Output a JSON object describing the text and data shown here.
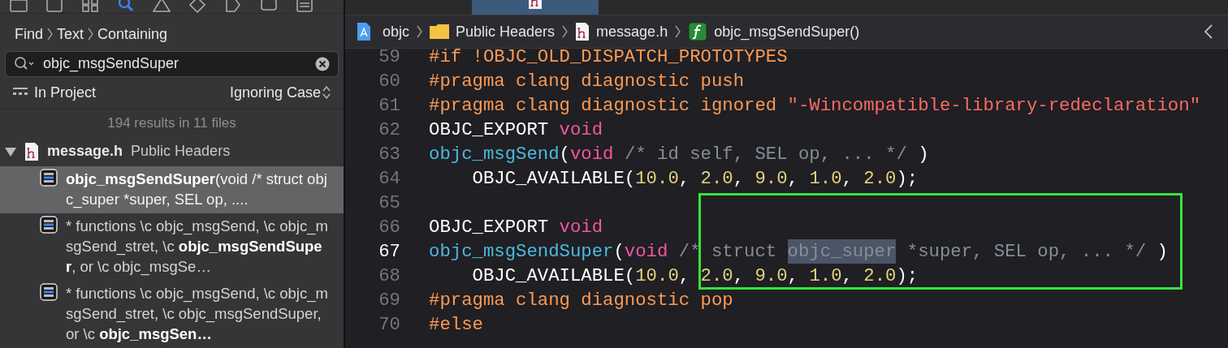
{
  "navigator": {
    "icons": [
      {
        "kind": "folder",
        "selected": false
      },
      {
        "kind": "square",
        "selected": false
      },
      {
        "kind": "grid",
        "selected": false
      },
      {
        "kind": "search",
        "selected": true
      },
      {
        "kind": "warning",
        "selected": false
      },
      {
        "kind": "diamond",
        "selected": false
      },
      {
        "kind": "tag",
        "selected": false
      },
      {
        "kind": "bubble",
        "selected": false
      },
      {
        "kind": "list",
        "selected": false
      }
    ],
    "find_path": [
      "Find",
      "Text",
      "Containing"
    ],
    "search": {
      "value": "objc_msgSendSuper"
    },
    "scope": "In Project",
    "matching": "Ignoring Case",
    "summary": "194 results in 11 files",
    "file": {
      "name": "message.h",
      "group": "Public Headers",
      "expanded": true
    },
    "results": [
      {
        "selected": true,
        "parts": [
          {
            "text": "objc_msgSendSuper",
            "bold": true
          },
          {
            "text": "(void /* struct objc_super *super, SEL op, ....",
            "bold": false
          }
        ]
      },
      {
        "selected": false,
        "parts": [
          {
            "text": "*  functions \\c objc_msgSend, \\c objc_msgSend_stret, \\c ",
            "bold": false
          },
          {
            "text": "objc_msgSendSuper",
            "bold": true
          },
          {
            "text": ", or \\c objc_msgSe…",
            "bold": false
          }
        ]
      },
      {
        "selected": false,
        "parts": [
          {
            "text": "*  functions \\c objc_msgSend, \\c objc_msgSend_stret, \\c objc_msgSendSuper, or \\c ",
            "bold": false
          },
          {
            "text": "objc_msgSen…",
            "bold": true
          }
        ]
      }
    ]
  },
  "breadcrumb": [
    {
      "kind": "project",
      "label": "objc"
    },
    {
      "kind": "folder",
      "label": "Public Headers"
    },
    {
      "kind": "header",
      "label": "message.h"
    },
    {
      "kind": "function",
      "label": "objc_msgSendSuper()"
    }
  ],
  "code": [
    {
      "number": "59",
      "current": false,
      "tokens": [
        {
          "kind": "preproc",
          "text": "#if !OBJC_OLD_DISPATCH_PROTOTYPES"
        }
      ]
    },
    {
      "number": "60",
      "current": false,
      "tokens": [
        {
          "kind": "preproc",
          "text": "#pragma clang diagnostic push"
        }
      ]
    },
    {
      "number": "61",
      "current": false,
      "tokens": [
        {
          "kind": "preproc",
          "text": "#pragma clang diagnostic ignored "
        },
        {
          "kind": "string",
          "text": "\"-Wincompatible-library-redeclaration\""
        }
      ]
    },
    {
      "number": "62",
      "current": false,
      "tokens": [
        {
          "kind": "plain",
          "text": "OBJC_EXPORT "
        },
        {
          "kind": "keyword",
          "text": "void"
        }
      ]
    },
    {
      "number": "63",
      "current": false,
      "tokens": [
        {
          "kind": "function",
          "text": "objc_msgSend"
        },
        {
          "kind": "plain",
          "text": "("
        },
        {
          "kind": "keyword",
          "text": "void"
        },
        {
          "kind": "comment",
          "text": " /* id self, SEL op, ... */"
        },
        {
          "kind": "plain",
          "text": " )"
        }
      ]
    },
    {
      "number": "64",
      "current": false,
      "tokens": [
        {
          "kind": "plain",
          "text": "    OBJC_AVAILABLE("
        },
        {
          "kind": "number",
          "text": "10.0"
        },
        {
          "kind": "plain",
          "text": ", "
        },
        {
          "kind": "number",
          "text": "2.0"
        },
        {
          "kind": "plain",
          "text": ", "
        },
        {
          "kind": "number",
          "text": "9.0"
        },
        {
          "kind": "plain",
          "text": ", "
        },
        {
          "kind": "number",
          "text": "1.0"
        },
        {
          "kind": "plain",
          "text": ", "
        },
        {
          "kind": "number",
          "text": "2.0"
        },
        {
          "kind": "plain",
          "text": ");"
        }
      ]
    },
    {
      "number": "65",
      "current": false
    },
    {
      "number": "66",
      "current": false,
      "tokens": [
        {
          "kind": "plain",
          "text": "OBJC_EXPORT "
        },
        {
          "kind": "keyword",
          "text": "void"
        }
      ]
    },
    {
      "number": "67",
      "current": true,
      "tokens": [
        {
          "kind": "function",
          "text": "objc_msgSendSuper"
        },
        {
          "kind": "plain",
          "text": "("
        },
        {
          "kind": "keyword",
          "text": "void"
        },
        {
          "kind": "comment",
          "text": " /* struct "
        },
        {
          "kind": "match",
          "text": "objc_super"
        },
        {
          "kind": "comment",
          "text": " *super, SEL op, ... */"
        },
        {
          "kind": "plain",
          "text": " )"
        }
      ]
    },
    {
      "number": "68",
      "current": false,
      "tokens": [
        {
          "kind": "plain",
          "text": "    OBJC_AVAILABLE("
        },
        {
          "kind": "number",
          "text": "10.0"
        },
        {
          "kind": "plain",
          "text": ", "
        },
        {
          "kind": "number",
          "text": "2.0"
        },
        {
          "kind": "plain",
          "text": ", "
        },
        {
          "kind": "number",
          "text": "9.0"
        },
        {
          "kind": "plain",
          "text": ", "
        },
        {
          "kind": "number",
          "text": "1.0"
        },
        {
          "kind": "plain",
          "text": ", "
        },
        {
          "kind": "number",
          "text": "2.0"
        },
        {
          "kind": "plain",
          "text": ");"
        }
      ]
    },
    {
      "number": "69",
      "current": false,
      "tokens": [
        {
          "kind": "preproc",
          "text": "#pragma clang diagnostic pop"
        }
      ]
    },
    {
      "number": "70",
      "current": false,
      "tokens": [
        {
          "kind": "preproc",
          "text": "#else"
        }
      ]
    }
  ]
}
